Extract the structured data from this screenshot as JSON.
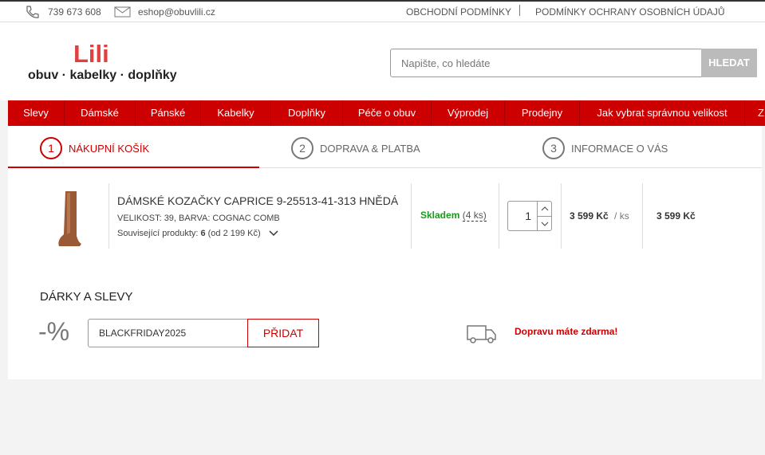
{
  "topbar": {
    "phone": "739 673 608",
    "email": "eshop@obuvlili.cz",
    "links": [
      "OBCHODNÍ PODMÍNKY",
      "PODMÍNKY OCHRANY OSOBNÍCH ÚDAJŮ"
    ]
  },
  "logo": {
    "name": "Lili",
    "tagline": "obuv · kabelky · doplňky"
  },
  "search": {
    "placeholder": "Napište, co hledáte",
    "button": "HLEDAT"
  },
  "nav": [
    "Slevy",
    "Dámské",
    "Pánské",
    "Kabelky",
    "Doplňky",
    "Péče o obuv",
    "Výprodej",
    "Prodejny",
    "Jak vybrat správnou velikost",
    "Z"
  ],
  "steps": [
    {
      "num": "1",
      "label": "NÁKUPNÍ KOŠÍK"
    },
    {
      "num": "2",
      "label": "DOPRAVA & PLATBA"
    },
    {
      "num": "3",
      "label": "INFORMACE O VÁS"
    }
  ],
  "item": {
    "name": "DÁMSKÉ KOZAČKY CAPRICE 9-25513-41-313 HNĚDÁ",
    "variant": "VELIKOST: 39, BARVA: COGNAC COMB",
    "related_label": "Související produkty:",
    "related_count": "6",
    "related_from": "(od 2 199 Kč)",
    "stock": "Skladem",
    "stock_qty": "(4 ks)",
    "quantity": "1",
    "unit_price": "3 599 Kč",
    "unit": "/ ks",
    "total": "3 599 Kč"
  },
  "gifts": {
    "title": "DÁRKY A SLEVY",
    "percent": "-%",
    "code": "BLACKFRIDAY2025",
    "add": "PŘIDAT",
    "shipping": "Dopravu máte zdarma!"
  },
  "colors": {
    "brand": "#cc0000",
    "stock": "#1a9a1a"
  }
}
